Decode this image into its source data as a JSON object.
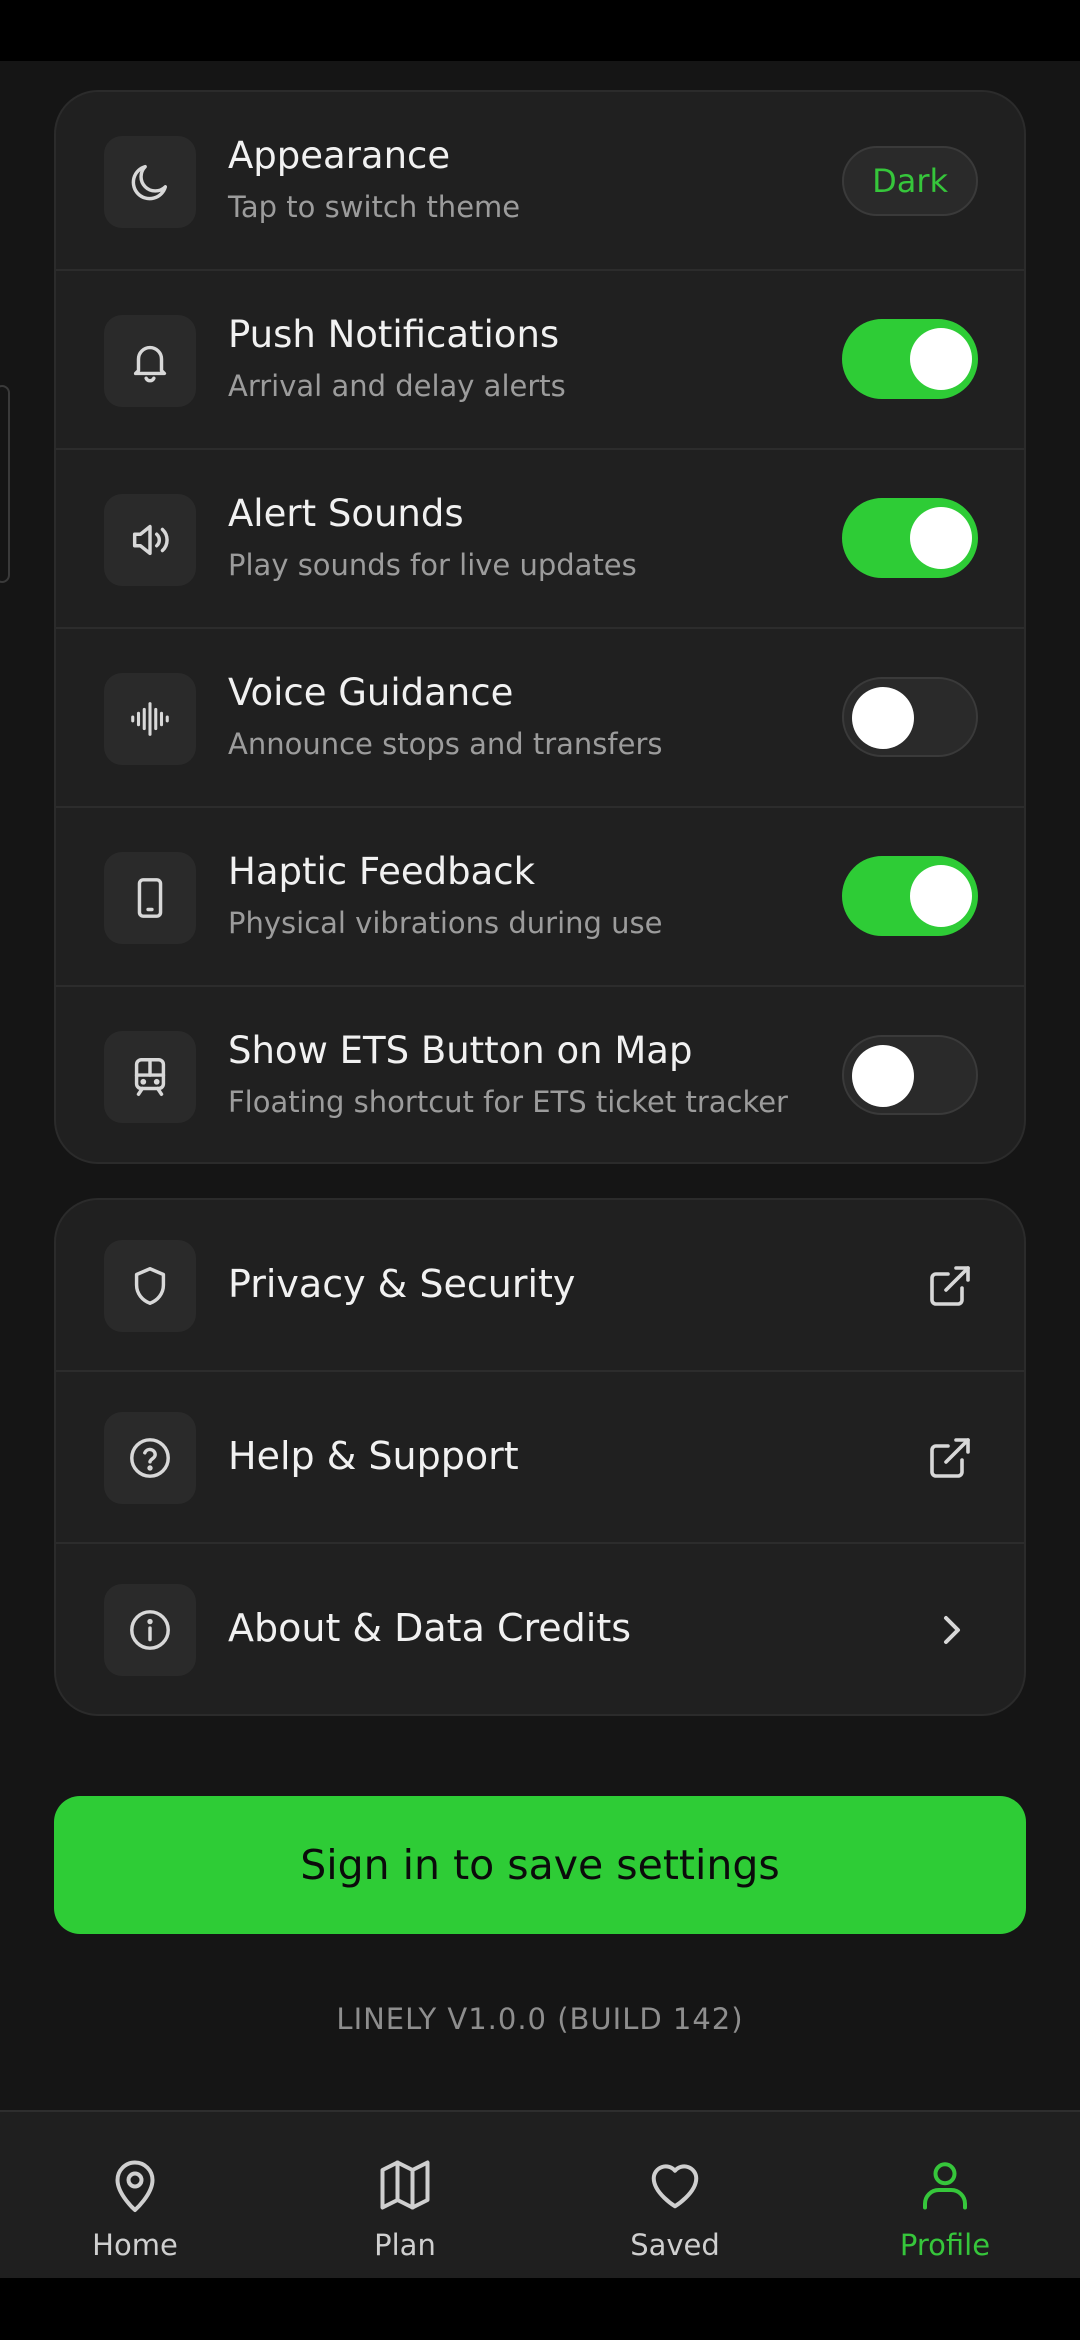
{
  "settings": [
    {
      "title": "Appearance",
      "subtitle": "Tap to switch theme",
      "control": "pill",
      "value": "Dark",
      "icon": "moon-icon"
    },
    {
      "title": "Push Notifications",
      "subtitle": "Arrival and delay alerts",
      "control": "toggle",
      "on": true,
      "icon": "bell-icon"
    },
    {
      "title": "Alert Sounds",
      "subtitle": "Play sounds for live updates",
      "control": "toggle",
      "on": true,
      "icon": "speaker-icon"
    },
    {
      "title": "Voice Guidance",
      "subtitle": "Announce stops and transfers",
      "control": "toggle",
      "on": false,
      "icon": "audio-wave-icon"
    },
    {
      "title": "Haptic Feedback",
      "subtitle": "Physical vibrations during use",
      "control": "toggle",
      "on": true,
      "icon": "phone-icon"
    },
    {
      "title": "Show ETS Button on Map",
      "subtitle": "Floating shortcut for ETS ticket tracker",
      "control": "toggle",
      "on": false,
      "icon": "train-icon"
    }
  ],
  "links": [
    {
      "title": "Privacy & Security",
      "icon": "shield-icon",
      "trail": "external-link-icon"
    },
    {
      "title": "Help & Support",
      "icon": "help-circle-icon",
      "trail": "external-link-icon"
    },
    {
      "title": "About & Data Credits",
      "icon": "info-icon",
      "trail": "chevron-right-icon"
    }
  ],
  "cta_label": "Sign in to save settings",
  "version": "LINELY V1.0.0 (BUILD 142)",
  "tabs": [
    {
      "label": "Home",
      "icon": "map-pin-icon",
      "active": false
    },
    {
      "label": "Plan",
      "icon": "map-icon",
      "active": false
    },
    {
      "label": "Saved",
      "icon": "heart-icon",
      "active": false
    },
    {
      "label": "Profile",
      "icon": "user-icon",
      "active": true
    }
  ],
  "colors": {
    "accent": "#2ecc36",
    "background": "#151515",
    "card": "#202020"
  }
}
